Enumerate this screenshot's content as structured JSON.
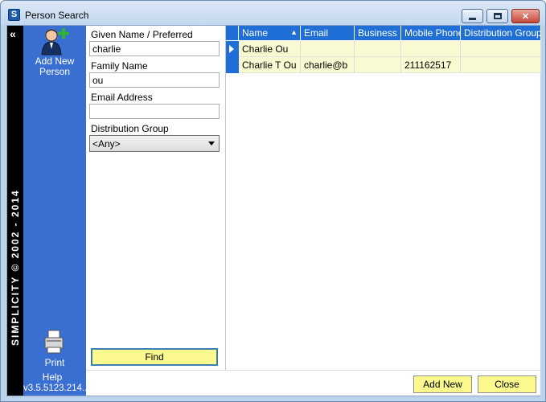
{
  "window": {
    "title": "Person Search",
    "app_icon_letter": "S",
    "controls": {
      "minimize": "",
      "maximize": "",
      "close": "✕"
    }
  },
  "brand": {
    "text": "SIMPLICITY © 2002 - 2014",
    "collapse_glyph": "«"
  },
  "command_panel": {
    "add_person_label": "Add New Person",
    "print_label": "Print",
    "help_label": "Help",
    "version": "v3.5.5123.214..."
  },
  "form": {
    "given_name_label": "Given Name / Preferred",
    "given_name_value": "charlie",
    "family_name_label": "Family Name",
    "family_name_value": "ou",
    "email_label": "Email Address",
    "email_value": "",
    "group_label": "Distribution Group",
    "group_value": "<Any>",
    "find_label": "Find"
  },
  "grid": {
    "sort_glyph": "▲",
    "columns": [
      "Name",
      "Email",
      "Business",
      "Mobile Phone",
      "Distribution Group"
    ],
    "rows": [
      {
        "name": "Charlie Ou",
        "email": "",
        "business": "",
        "mobile": "",
        "group": ""
      },
      {
        "name": "Charlie T Ou",
        "email": "charlie@b",
        "business": "",
        "mobile": "211162517",
        "group": ""
      }
    ]
  },
  "footer": {
    "add_new_label": "Add New",
    "close_label": "Close"
  },
  "colors": {
    "panel_blue": "#3a6fd2",
    "header_blue": "#1f6fd6",
    "button_yellow": "#fbf98e",
    "row_yellow": "#fafad2"
  }
}
